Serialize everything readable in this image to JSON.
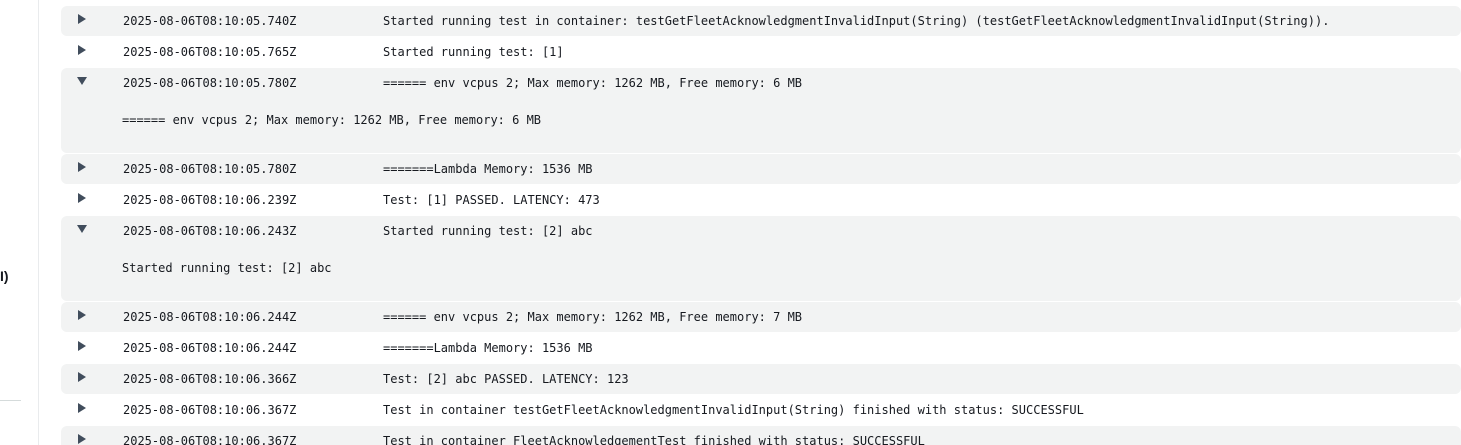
{
  "left_panel": {
    "fragment": "I)"
  },
  "log_events": [
    {
      "timestamp": "2025-08-06T08:10:05.740Z",
      "message": "Started running test in container: testGetFleetAcknowledgmentInvalidInput(String) (testGetFleetAcknowledgmentInvalidInput(String)).",
      "expanded": false
    },
    {
      "timestamp": "2025-08-06T08:10:05.765Z",
      "message": "Started running test: [1]",
      "expanded": false
    },
    {
      "timestamp": "2025-08-06T08:10:05.780Z",
      "message": "====== env vcpus 2; Max memory: 1262 MB, Free memory: 6 MB",
      "expanded": true,
      "detail": "====== env vcpus 2; Max memory: 1262 MB, Free memory: 6 MB"
    },
    {
      "timestamp": "2025-08-06T08:10:05.780Z",
      "message": "=======Lambda Memory: 1536 MB",
      "expanded": false
    },
    {
      "timestamp": "2025-08-06T08:10:06.239Z",
      "message": "Test: [1] PASSED. LATENCY: 473",
      "expanded": false
    },
    {
      "timestamp": "2025-08-06T08:10:06.243Z",
      "message": "Started running test: [2] abc",
      "expanded": true,
      "detail": "Started running test: [2] abc"
    },
    {
      "timestamp": "2025-08-06T08:10:06.244Z",
      "message": "====== env vcpus 2; Max memory: 1262 MB, Free memory: 7 MB",
      "expanded": false
    },
    {
      "timestamp": "2025-08-06T08:10:06.244Z",
      "message": "=======Lambda Memory: 1536 MB",
      "expanded": false
    },
    {
      "timestamp": "2025-08-06T08:10:06.366Z",
      "message": "Test: [2] abc PASSED. LATENCY: 123",
      "expanded": false
    },
    {
      "timestamp": "2025-08-06T08:10:06.367Z",
      "message": "Test in container testGetFleetAcknowledgmentInvalidInput(String) finished with status: SUCCESSFUL",
      "expanded": false
    },
    {
      "timestamp": "2025-08-06T08:10:06.367Z",
      "message": "Test in container FleetAcknowledgementTest finished with status: SUCCESSFUL",
      "expanded": false
    }
  ],
  "icons": {
    "collapsed": "caret-right-icon",
    "expanded": "caret-down-icon"
  },
  "colors": {
    "row_shaded": "#f2f3f3",
    "text": "#16191f",
    "caret": "#414d5c"
  }
}
